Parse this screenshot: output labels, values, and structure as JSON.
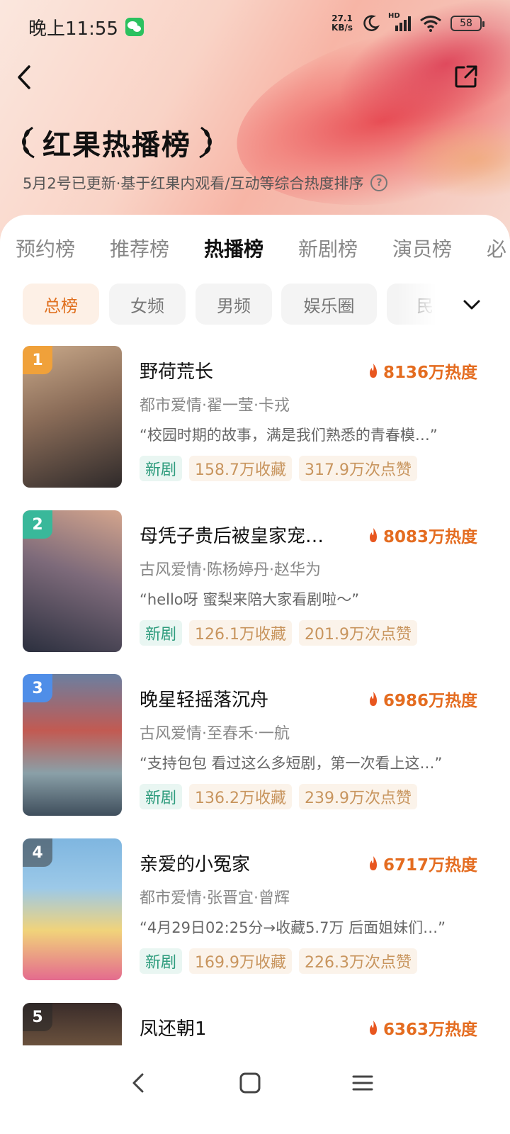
{
  "status_bar": {
    "time": "晚上11:55",
    "net_speed_value": "27.1",
    "net_speed_unit": "KB/s",
    "signal_label": "HD",
    "battery": "58",
    "icons": [
      "wechat-icon",
      "moon-icon",
      "signal-icon",
      "wifi-icon",
      "battery-icon"
    ]
  },
  "header": {
    "title": "红果热播榜",
    "subtitle": "5月2号已更新·基于红果内观看/互动等综合热度排序",
    "help_glyph": "?"
  },
  "tabs": [
    {
      "label": "预约榜",
      "active": false
    },
    {
      "label": "推荐榜",
      "active": false
    },
    {
      "label": "热播榜",
      "active": true
    },
    {
      "label": "新剧榜",
      "active": false
    },
    {
      "label": "演员榜",
      "active": false
    },
    {
      "label": "必",
      "active": false
    }
  ],
  "chips": [
    {
      "label": "总榜",
      "active": true
    },
    {
      "label": "女频",
      "active": false
    },
    {
      "label": "男频",
      "active": false
    },
    {
      "label": "娱乐圈",
      "active": false
    },
    {
      "label": "民",
      "active": false
    }
  ],
  "items": [
    {
      "rank": "1",
      "rank_color": "#f0a13a",
      "title": "野荷荒长",
      "heat": "8136万热度",
      "meta": "都市爱情·翟一莹·卡戎",
      "quote": "“校园时期的故事，满是我们熟悉的青春模…”",
      "tag_new": "新剧",
      "favorites": "158.7万收藏",
      "likes": "317.9万次点赞",
      "cover_colors": [
        "#6f5a4a",
        "#c9a98a",
        "#2f2a2a"
      ]
    },
    {
      "rank": "2",
      "rank_color": "#39b89a",
      "title": "母凭子贵后被皇家宠…",
      "heat": "8083万热度",
      "meta": "古风爱情·陈杨婷丹·赵华为",
      "quote": "“hello呀 蜜梨来陪大家看剧啦～”",
      "tag_new": "新剧",
      "favorites": "126.1万收藏",
      "likes": "201.9万次点赞",
      "cover_colors": [
        "#4a5368",
        "#d4a58d",
        "#2b2f3e"
      ]
    },
    {
      "rank": "3",
      "rank_color": "#4f8ee8",
      "title": "晚星轻摇落沉舟",
      "heat": "6986万热度",
      "meta": "古风爱情·至春禾·一航",
      "quote": "“支持包包 看过这么多短剧，第一次看上这…”",
      "tag_new": "新剧",
      "favorites": "136.2万收藏",
      "likes": "239.9万次点赞",
      "cover_colors": [
        "#6b7fa0",
        "#c25a52",
        "#3f4e5c"
      ]
    },
    {
      "rank": "4",
      "rank_color": "#6a6a6a",
      "title": "亲爱的小冤家",
      "heat": "6717万热度",
      "meta": "都市爱情·张晋宜·曾辉",
      "quote": "“4月29日02:25分→收藏5.7万 后面姐妹们…”",
      "tag_new": "新剧",
      "favorites": "169.9万收藏",
      "likes": "226.3万次点赞",
      "cover_colors": [
        "#7fb6e0",
        "#f1d37a",
        "#e46b8e"
      ]
    },
    {
      "rank": "5",
      "rank_color": "#5b5b5b",
      "title": "凤还朝1",
      "heat": "6363万热度",
      "meta": "",
      "quote": "",
      "tag_new": "",
      "favorites": "",
      "likes": "",
      "cover_colors": [
        "#3a2c2a",
        "#8a6a4a",
        "#2a2222"
      ]
    }
  ],
  "nav": {
    "icons": [
      "back-nav-icon",
      "home-nav-icon",
      "menu-nav-icon"
    ]
  },
  "colors": {
    "accent": "#e46c20",
    "chip_active_bg": "#fdf0e6",
    "new_tag": "#2e9c7d",
    "stat_tag": "#c8955e"
  }
}
